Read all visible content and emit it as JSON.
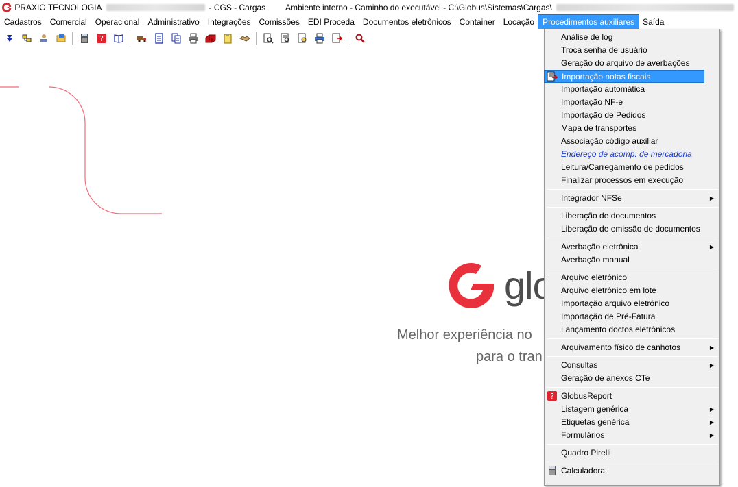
{
  "window": {
    "app_name": "PRAXIO TECNOLOGIA",
    "module": "- CGS - Cargas",
    "environment": "Ambiente interno - Caminho do executável - C:\\Globus\\Sistemas\\Cargas\\"
  },
  "menubar": [
    {
      "label": "Cadastros"
    },
    {
      "label": "Comercial"
    },
    {
      "label": "Operacional"
    },
    {
      "label": "Administrativo"
    },
    {
      "label": "Integrações"
    },
    {
      "label": "Comissões"
    },
    {
      "label": "EDI Proceda"
    },
    {
      "label": "Documentos eletrônicos"
    },
    {
      "label": "Container"
    },
    {
      "label": "Locação"
    },
    {
      "label": "Procedimentos auxiliares"
    },
    {
      "label": "Saída"
    }
  ],
  "brand": {
    "wordmark": "glo",
    "tagline_line1": "Melhor experiência no",
    "tagline_line2": "para o tran",
    "accent_color": "#e8313c"
  },
  "dropdown": {
    "items": [
      "Análise de log",
      "Troca senha de usuário",
      "Geração do arquivo de averbações",
      "Importação notas fiscais",
      "Importação automática",
      "Importação NF-e",
      "Importação de Pedidos",
      "Mapa de transportes",
      "Associação código auxiliar",
      "Endereço de acomp. de mercadoria",
      "Leitura/Carregamento de pedidos",
      "Finalizar processos em execução",
      "Integrador NFSe",
      "Liberação de documentos",
      "Liberação de emissão de documentos",
      "Averbação eletrônica",
      "Averbação manual",
      "Arquivo eletrônico",
      "Arquivo eletrônico em lote",
      "Importação arquivo eletrônico",
      "Importação de Pré-Fatura",
      "Lançamento doctos eletrônicos",
      "Arquivamento físico de canhotos",
      "Consultas",
      "Geração de anexos CTe",
      "GlobusReport",
      "Listagem genérica",
      "Etiquetas genérica",
      "Formulários",
      "Quadro Pirelli",
      "Calculadora"
    ],
    "highlight_color": "#3399ff",
    "italic_color": "#1a3bd1"
  }
}
